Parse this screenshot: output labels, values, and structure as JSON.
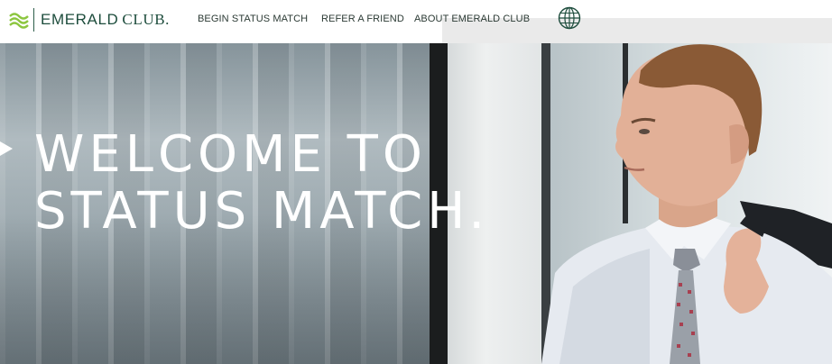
{
  "header": {
    "logo": {
      "brand": "EMERALD",
      "brand_suffix": "CLUB."
    },
    "nav": [
      {
        "label": "BEGIN STATUS MATCH"
      },
      {
        "label": "REFER A FRIEND"
      },
      {
        "label": "ABOUT EMERALD CLUB"
      }
    ],
    "globe_icon": "globe-icon"
  },
  "hero": {
    "title_line1": "WELCOME TO",
    "title_line2": "STATUS MATCH."
  },
  "colors": {
    "brand_green": "#1e4d3d",
    "nav_text": "#2b3a34",
    "hero_text": "#ffffff"
  }
}
